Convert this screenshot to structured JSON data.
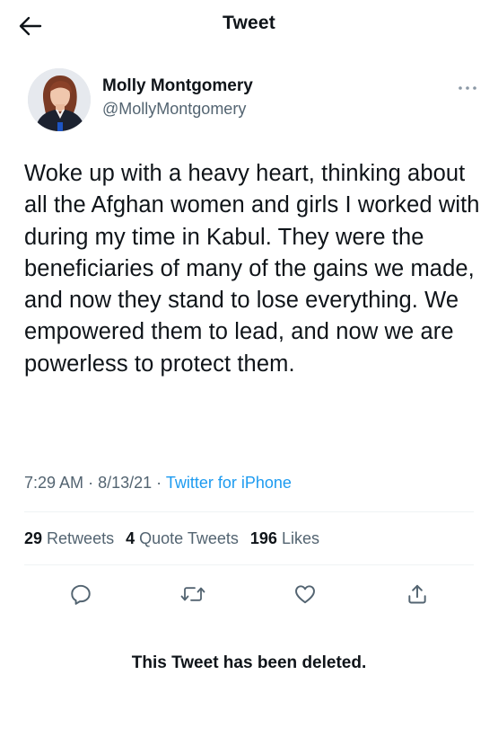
{
  "header": {
    "title": "Tweet",
    "back_icon": "arrow-left-icon"
  },
  "author": {
    "name": "Molly Montgomery",
    "handle": "@MollyMontgomery",
    "avatar_icon": "profile-photo",
    "more_icon": "more-horizontal-icon"
  },
  "tweet": {
    "text": "Woke up with a heavy heart, thinking about all the Afghan women and girls I worked with during my time in Kabul. They were the beneficiaries of many of the gains we made, and now they stand to lose everything. We empowered them to lead, and now we are powerless to protect them.",
    "time": "7:29 AM",
    "date": "8/13/21",
    "separator": "·",
    "source": "Twitter for iPhone"
  },
  "stats": {
    "retweets_count": "29",
    "retweets_label": "Retweets",
    "quotes_count": "4",
    "quotes_label": "Quote Tweets",
    "likes_count": "196",
    "likes_label": "Likes"
  },
  "actions": {
    "reply_icon": "reply-icon",
    "retweet_icon": "retweet-icon",
    "like_icon": "heart-icon",
    "share_icon": "share-icon"
  },
  "notice": {
    "deleted_text": "This Tweet has been deleted."
  },
  "colors": {
    "text": "#0f1419",
    "secondary_text": "#536471",
    "link": "#1d9bf0",
    "divider": "#eff3f4"
  }
}
